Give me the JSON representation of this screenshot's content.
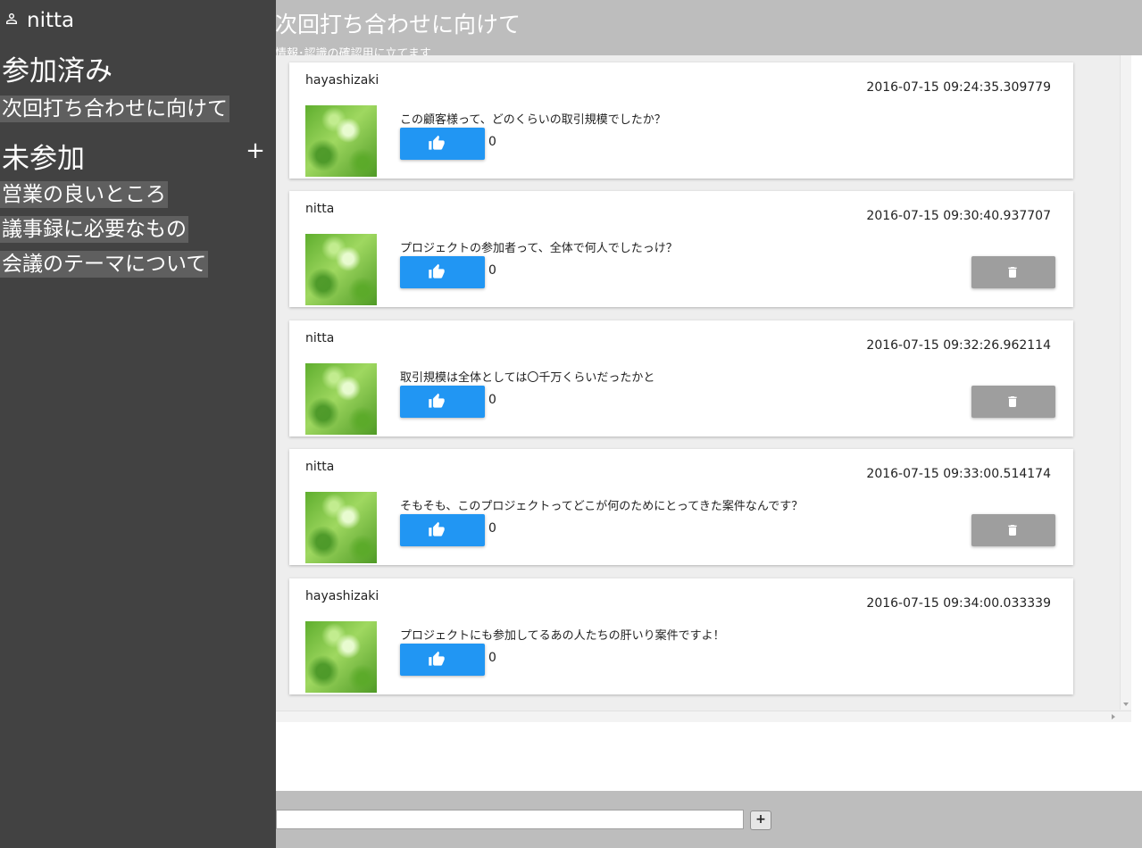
{
  "sidebar": {
    "user": {
      "name": "nitta",
      "icon": "person-icon"
    },
    "joined_heading": "参加済み",
    "joined_rooms": [
      {
        "label": "次回打ち合わせに向けて"
      }
    ],
    "unjoined_heading": "未参加",
    "add_label": "+",
    "unjoined_rooms": [
      {
        "label": "営業の良いところ"
      },
      {
        "label": "議事録に必要なもの"
      },
      {
        "label": "会議のテーマについて"
      }
    ]
  },
  "header": {
    "title": "次回打ち合わせに向けて",
    "subtitle": "情報･認識の確認用に立てます"
  },
  "messages": [
    {
      "author": "hayashizaki",
      "timestamp": "2016-07-15 09:24:35.309779",
      "text": "この顧客様って、どのくらいの取引規模でしたか？",
      "likes": "0",
      "deletable": false
    },
    {
      "author": "nitta",
      "timestamp": "2016-07-15 09:30:40.937707",
      "text": "プロジェクトの参加者って、全体で何人でしたっけ？",
      "likes": "0",
      "deletable": true
    },
    {
      "author": "nitta",
      "timestamp": "2016-07-15 09:32:26.962114",
      "text": "取引規模は全体としては〇千万くらいだったかと",
      "likes": "0",
      "deletable": true
    },
    {
      "author": "nitta",
      "timestamp": "2016-07-15 09:33:00.514174",
      "text": "そもそも、このプロジェクトってどこが何のためにとってきた案件なんです？",
      "likes": "0",
      "deletable": true
    },
    {
      "author": "hayashizaki",
      "timestamp": "2016-07-15 09:34:00.033339",
      "text": "プロジェクトにも参加してるあの人たちの肝いり案件ですよ！",
      "likes": "0",
      "deletable": false
    }
  ],
  "footer": {
    "input_value": "",
    "send_label": "+"
  },
  "colors": {
    "sidebar_bg": "#424242",
    "header_bg": "#bdbdbd",
    "like_button": "#2196f3",
    "delete_button": "#9e9e9e"
  }
}
